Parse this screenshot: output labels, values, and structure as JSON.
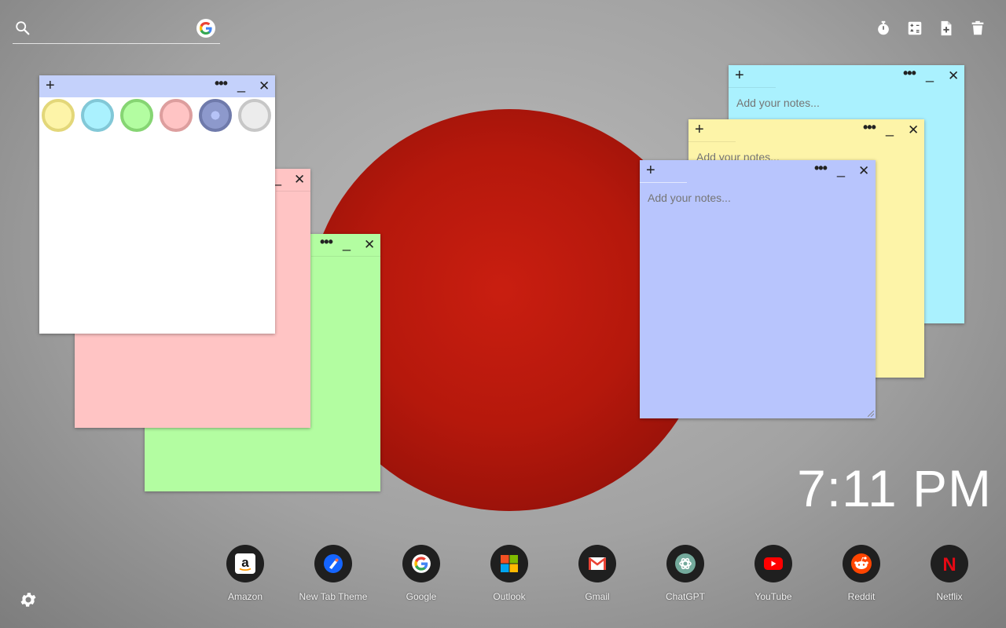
{
  "search": {
    "placeholder": ""
  },
  "tools": [
    "stopwatch-icon",
    "calculator-icon",
    "add-note-icon",
    "trash-icon"
  ],
  "note_placeholder": "Add your notes...",
  "notes": {
    "white": {
      "color": "#ffffff",
      "bar": "#c4d1fb",
      "add": "+",
      "more": "•••",
      "min": "_",
      "close": "✕"
    },
    "pink": {
      "color": "#ffc4c4",
      "min": "_",
      "close": "✕"
    },
    "green": {
      "color": "#b3fda1",
      "more": "•••",
      "min": "_",
      "close": "✕"
    },
    "cyan": {
      "color": "#aaf1fe",
      "add": "+",
      "more": "•••",
      "min": "_",
      "close": "✕"
    },
    "yellow": {
      "color": "#fdf4a8",
      "add": "+",
      "more": "•••",
      "min": "_",
      "close": "✕"
    },
    "blue": {
      "color": "#b8c5fd",
      "add": "+",
      "more": "•••",
      "min": "_",
      "close": "✕"
    }
  },
  "swatches": [
    {
      "name": "yellow",
      "fill": "#fdf4a8",
      "ring": "#e3d779"
    },
    {
      "name": "cyan",
      "fill": "#aaf1fe",
      "ring": "#82c8d7"
    },
    {
      "name": "green",
      "fill": "#b3fda1",
      "ring": "#86d573"
    },
    {
      "name": "pink",
      "fill": "#ffc4c4",
      "ring": "#dd9e9e"
    },
    {
      "name": "blue",
      "fill": "#8d99cc",
      "ring": "#6f7aab",
      "selected": true
    },
    {
      "name": "white",
      "fill": "#ececec",
      "ring": "#c7c7c7"
    }
  ],
  "clock": {
    "time": "7:11 PM"
  },
  "shortcuts": [
    {
      "label": "Amazon",
      "icon": "amazon-icon"
    },
    {
      "label": "New Tab Theme",
      "icon": "new-tab-theme-icon"
    },
    {
      "label": "Google",
      "icon": "google-icon"
    },
    {
      "label": "Outlook",
      "icon": "outlook-icon"
    },
    {
      "label": "Gmail",
      "icon": "gmail-icon"
    },
    {
      "label": "ChatGPT",
      "icon": "chatgpt-icon"
    },
    {
      "label": "YouTube",
      "icon": "youtube-icon"
    },
    {
      "label": "Reddit",
      "icon": "reddit-icon"
    },
    {
      "label": "Netflix",
      "icon": "netflix-icon"
    }
  ],
  "icon_glyphs": {
    "amazon": "a",
    "netflix": "N"
  }
}
